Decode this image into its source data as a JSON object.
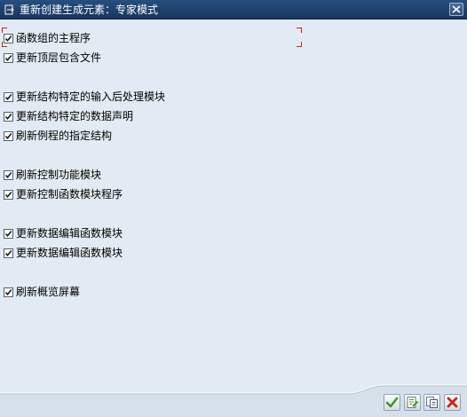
{
  "window": {
    "title": "重新创建生成元素：专家模式"
  },
  "options": [
    {
      "label": "函数组的主程序",
      "checked": true
    },
    {
      "label": "更新顶层包含文件",
      "checked": true
    },
    {
      "label": "更新结构特定的输入后处理模块",
      "checked": true
    },
    {
      "label": "更新结构特定的数据声明",
      "checked": true
    },
    {
      "label": "刷新例程的指定结构",
      "checked": true
    },
    {
      "label": "刷新控制功能模块",
      "checked": true
    },
    {
      "label": "更新控制函数模块程序",
      "checked": true
    },
    {
      "label": "更新数据编辑函数模块",
      "checked": true
    },
    {
      "label": "更新数据编辑函数模块",
      "checked": true
    },
    {
      "label": "刷新概览屏幕",
      "checked": true
    }
  ],
  "footer_buttons": [
    {
      "icon": "checkmark-icon",
      "color": "#3f9a1d"
    },
    {
      "icon": "document-edit-icon",
      "color": "#6f8a1d"
    },
    {
      "icon": "document-copy-icon",
      "color": "#4a5a6a"
    },
    {
      "icon": "cancel-x-icon",
      "color": "#c8261b"
    }
  ],
  "colors": {
    "titlebar": "#1f436f",
    "background": "#e2ebf3",
    "focus_marker": "#d0211f"
  }
}
